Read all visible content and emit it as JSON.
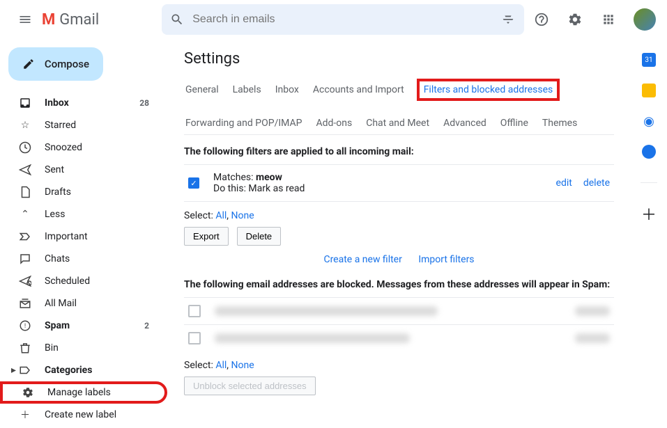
{
  "header": {
    "product": "Gmail",
    "search_placeholder": "Search in emails"
  },
  "compose_label": "Compose",
  "sidebar": {
    "items": [
      {
        "label": "Inbox",
        "count": "28",
        "bold": true
      },
      {
        "label": "Starred"
      },
      {
        "label": "Snoozed"
      },
      {
        "label": "Sent"
      },
      {
        "label": "Drafts"
      },
      {
        "label": "Less"
      },
      {
        "label": "Important"
      },
      {
        "label": "Chats"
      },
      {
        "label": "Scheduled"
      },
      {
        "label": "All Mail"
      },
      {
        "label": "Spam",
        "count": "2",
        "bold": true
      },
      {
        "label": "Bin"
      },
      {
        "label": "Categories",
        "bold": true
      },
      {
        "label": "Manage labels"
      },
      {
        "label": "Create new label"
      }
    ]
  },
  "settings": {
    "title": "Settings",
    "tabs": [
      "General",
      "Labels",
      "Inbox",
      "Accounts and Import",
      "Filters and blocked addresses",
      "Forwarding and POP/IMAP",
      "Add-ons",
      "Chat and Meet",
      "Advanced",
      "Offline",
      "Themes"
    ],
    "filters_heading": "The following filters are applied to all incoming mail:",
    "filter": {
      "matches_label": "Matches: ",
      "matches_value": "meow",
      "do_this": "Do this: Mark as read",
      "edit": "edit",
      "delete": "delete"
    },
    "select_label": "Select: ",
    "select_all": "All",
    "select_none": "None",
    "export_btn": "Export",
    "delete_btn": "Delete",
    "create_filter": "Create a new filter",
    "import_filters": "Import filters",
    "blocked_heading": "The following email addresses are blocked. Messages from these addresses will appear in Spam:",
    "unblock_btn": "Unblock selected addresses"
  }
}
